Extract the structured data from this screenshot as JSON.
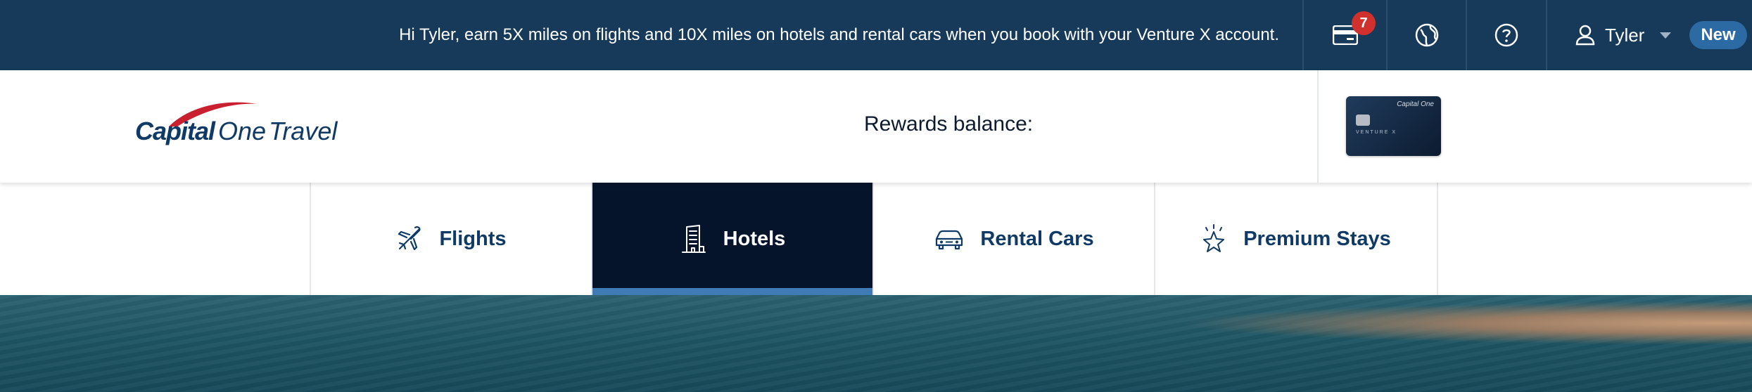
{
  "topbar": {
    "promo_text": "Hi Tyler, earn 5X miles on flights and 10X miles on hotels and rental cars when you book with your Venture X account.",
    "notifications_count": "7",
    "user_name": "Tyler",
    "new_label": "New",
    "icons": [
      "wallet-icon",
      "globe-icon",
      "help-icon",
      "user-icon",
      "chevron-down-icon"
    ]
  },
  "header": {
    "logo_word1": "Capital",
    "logo_word2": "One",
    "logo_word3": "Travel",
    "rewards_label": "Rewards balance:",
    "card_brand": "Capital One",
    "card_name": "VENTURE X"
  },
  "tabs": [
    {
      "label": "Flights",
      "icon": "airplane-icon",
      "active": false
    },
    {
      "label": "Hotels",
      "icon": "hotel-icon",
      "active": true
    },
    {
      "label": "Rental Cars",
      "icon": "car-icon",
      "active": false
    },
    {
      "label": "Premium Stays",
      "icon": "star-icon",
      "active": false
    }
  ],
  "colors": {
    "topbar_bg": "#173a5a",
    "active_tab_bg": "#06142b",
    "active_tab_underline": "#3f7cb6",
    "badge": "#d0312d",
    "brand_text": "#0f3a66"
  }
}
